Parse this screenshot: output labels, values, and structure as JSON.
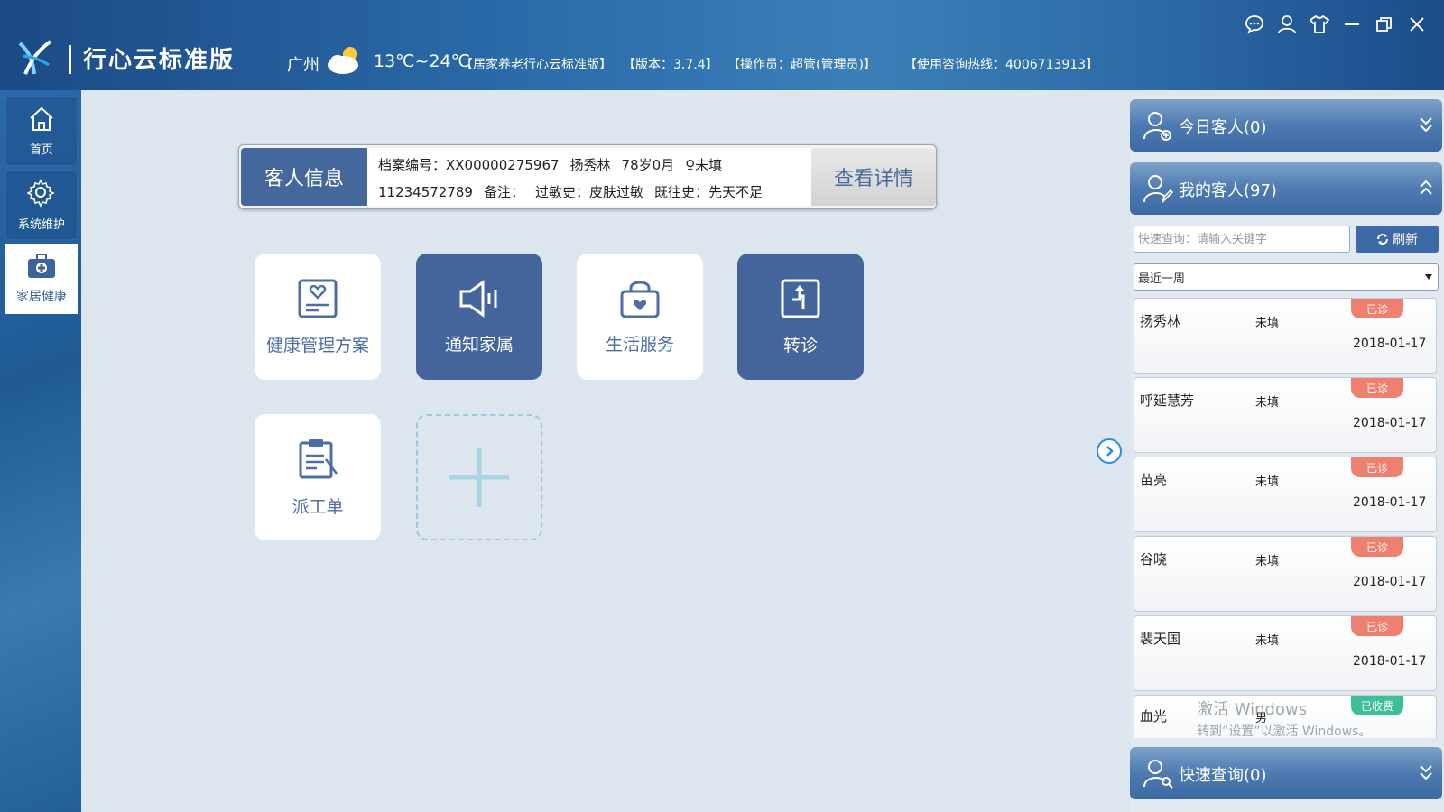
{
  "app": {
    "title": "行心云标准版",
    "city": "广州",
    "temperature": "13℃~24℃",
    "info": [
      "【居家养老行心云标准版】",
      "【版本：3.7.4】",
      "【操作员：超管(管理员)】",
      "【使用咨询热线：4006713913】"
    ]
  },
  "nav": [
    {
      "label": "首页",
      "icon": "home-icon"
    },
    {
      "label": "系统维护",
      "icon": "gear-icon"
    },
    {
      "label": "家居健康",
      "icon": "medical-kit-icon"
    }
  ],
  "guest": {
    "label": "客人信息",
    "line1": [
      "档案编号：XX00000275967",
      "扬秀林",
      "78岁0月",
      "♀未填"
    ],
    "line2": [
      "11234572789",
      "备注：",
      "过敏史：皮肤过敏",
      "既往史：先天不足"
    ],
    "detail_label": "查看详情"
  },
  "tiles": [
    {
      "label": "健康管理方案",
      "icon": "health-plan-icon",
      "style": "light"
    },
    {
      "label": "通知家属",
      "icon": "speaker-icon",
      "style": "dark"
    },
    {
      "label": "生活服务",
      "icon": "service-bag-icon",
      "style": "light"
    },
    {
      "label": "转诊",
      "icon": "transfer-icon",
      "style": "dark"
    },
    {
      "label": "派工单",
      "icon": "clipboard-icon",
      "style": "light"
    }
  ],
  "right_panel": {
    "today_title": "今日客人(0)",
    "my_title": "我的客人(97)",
    "quick_title": "快速查询(0)",
    "search_placeholder": "快速查询：请输入关键字",
    "refresh_label": "刷新",
    "range": "最近一周",
    "customers": [
      {
        "name": "扬秀林",
        "gender": "未填",
        "date": "2018-01-17",
        "status": "已诊"
      },
      {
        "name": "呼延慧芳",
        "gender": "未填",
        "date": "2018-01-17",
        "status": "已诊"
      },
      {
        "name": "苗亮",
        "gender": "未填",
        "date": "2018-01-17",
        "status": "已诊"
      },
      {
        "name": "谷晓",
        "gender": "未填",
        "date": "2018-01-17",
        "status": "已诊"
      },
      {
        "name": "裴天国",
        "gender": "未填",
        "date": "2018-01-17",
        "status": "已诊"
      },
      {
        "name": "血光",
        "gender": "男",
        "date": "",
        "status": "已收费"
      }
    ]
  },
  "watermark": {
    "line1": "激活 Windows",
    "line2": "转到“设置”以激活 Windows。"
  },
  "colors": {
    "badge_done": "#ef8070",
    "badge_paid": "#3dbf9a",
    "accent": "#44649c"
  }
}
